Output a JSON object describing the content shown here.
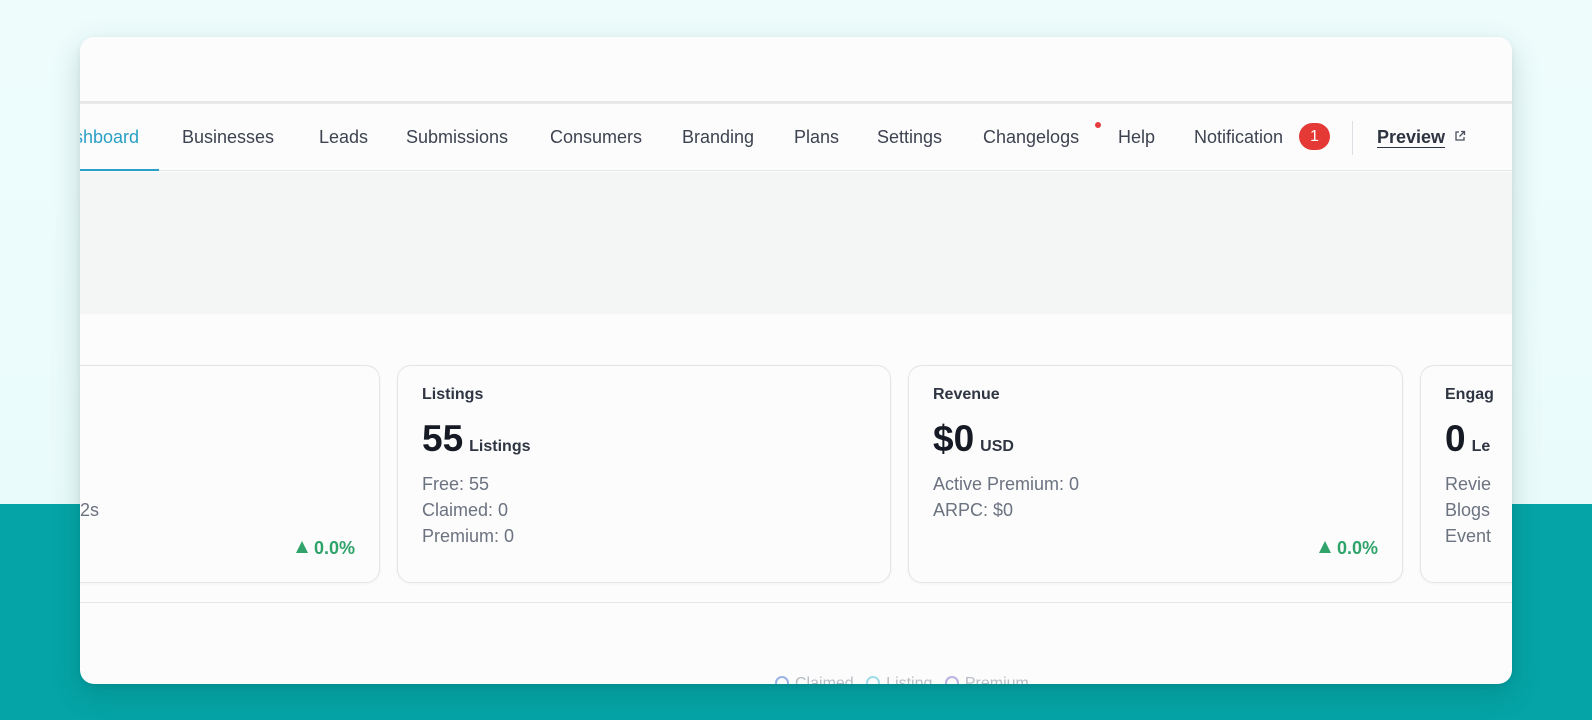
{
  "nav": {
    "items": [
      {
        "label": "shboard",
        "active": true
      },
      {
        "label": "Businesses"
      },
      {
        "label": "Leads"
      },
      {
        "label": "Submissions"
      },
      {
        "label": "Consumers"
      },
      {
        "label": "Branding"
      },
      {
        "label": "Plans"
      },
      {
        "label": "Settings"
      },
      {
        "label": "Changelogs",
        "has_dot": true
      },
      {
        "label": "Help"
      },
      {
        "label": "Notification",
        "badge": "1"
      }
    ],
    "preview_label": "Preview",
    "preview_icon": "external-link-icon"
  },
  "cards": {
    "first": {
      "line": "2s",
      "change": "0.0%"
    },
    "listings": {
      "title": "Listings",
      "value": "55",
      "unit": "Listings",
      "lines": [
        "Free: 55",
        "Claimed: 0",
        "Premium: 0"
      ]
    },
    "revenue": {
      "title": "Revenue",
      "value": "$0",
      "unit": "USD",
      "lines": [
        "Active Premium: 0",
        "ARPC: $0"
      ],
      "change": "0.0%"
    },
    "engagement": {
      "title": "Engag",
      "value": "0",
      "unit": "Le",
      "lines": [
        "Revie",
        "Blogs",
        "Event"
      ]
    }
  },
  "legend": {
    "items": [
      {
        "label": "Claimed",
        "color": "#9bb3e6"
      },
      {
        "label": "Listing",
        "color": "#9fdde6"
      },
      {
        "label": "Premium",
        "color": "#b9b3e0"
      }
    ]
  },
  "colors": {
    "accent": "#2b9fc5",
    "positive": "#2fa36a",
    "badge": "#e53935",
    "background_band": "#05a4a6"
  }
}
